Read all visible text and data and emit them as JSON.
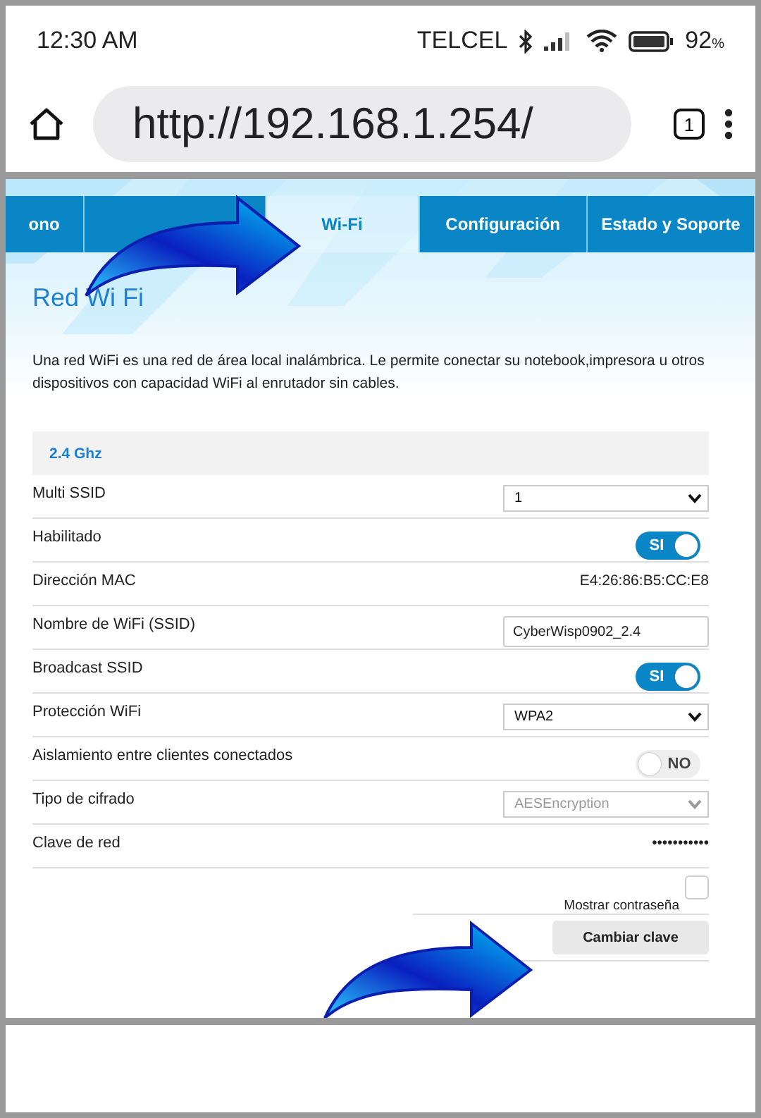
{
  "status_bar": {
    "time": "12:30 AM",
    "carrier": "TELCEL",
    "battery": "92",
    "battery_unit": "%"
  },
  "browser": {
    "url": "http://192.168.1.254/",
    "tab_count": "1"
  },
  "tabs": [
    {
      "label": "ono",
      "selected": false
    },
    {
      "selected": false
    },
    {
      "label": "Wi-Fi",
      "selected": true
    },
    {
      "label": "Configuración",
      "selected": false
    },
    {
      "label": "Estado y Soporte",
      "selected": false
    }
  ],
  "page": {
    "title": "Red Wi Fi",
    "description": "Una red WiFi es una red de área local inalámbrica. Le permite conectar su notebook,impresora u otros dispositivos con capacidad WiFi al enrutador sin cables.",
    "band": "2.4 Ghz"
  },
  "settings": [
    {
      "kind": "select",
      "label": "Multi SSID",
      "value": "1",
      "disabled": false
    },
    {
      "kind": "toggle",
      "label": "Habilitado",
      "on": true,
      "value": "SI"
    },
    {
      "kind": "text",
      "label": "Dirección MAC",
      "value": "E4:26:86:B5:CC:E8"
    },
    {
      "kind": "input",
      "label": "Nombre de WiFi (SSID)",
      "value": "CyberWisp0902_2.4"
    },
    {
      "kind": "toggle",
      "label": "Broadcast SSID",
      "on": true,
      "value": "SI"
    },
    {
      "kind": "select",
      "label": "Protección WiFi",
      "value": "WPA2",
      "disabled": false
    },
    {
      "kind": "toggle",
      "label": "Aislamiento entre clientes conectados",
      "on": false,
      "value": "NO"
    },
    {
      "kind": "select",
      "label": "Tipo de cifrado",
      "value": "AESEncryption",
      "disabled": true
    },
    {
      "kind": "text",
      "label": "Clave de red",
      "value": "•••••••••••"
    }
  ],
  "show_password": {
    "label": "Mostrar contraseña",
    "checked": false
  },
  "change_button": "Cambiar clave"
}
